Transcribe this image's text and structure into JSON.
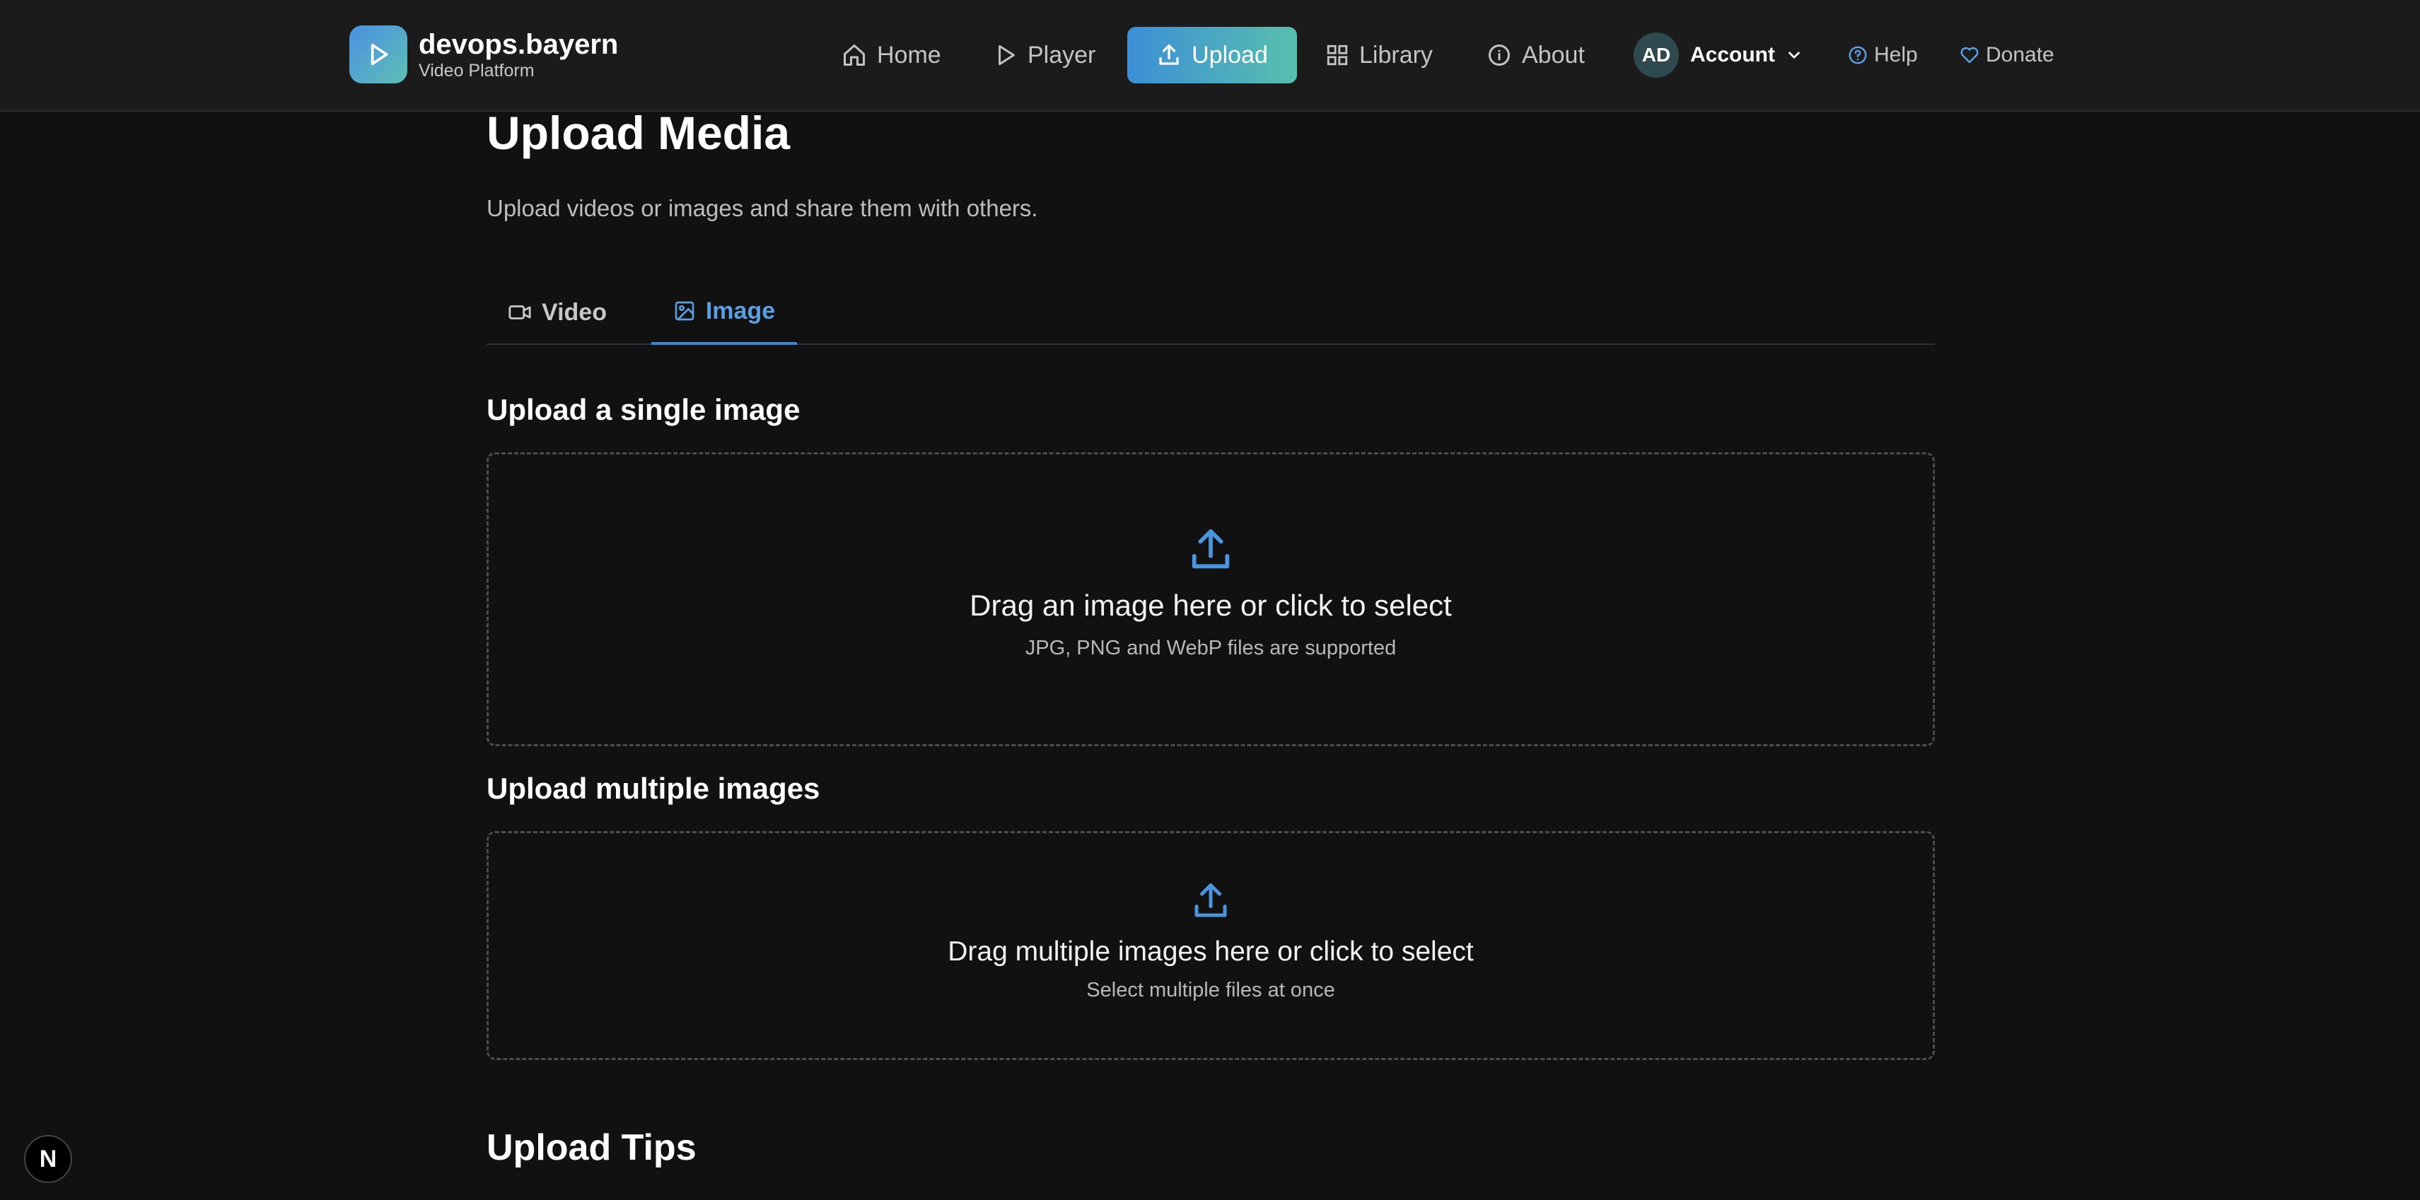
{
  "brand": {
    "name": "devops.bayern",
    "subtitle": "Video Platform"
  },
  "nav": {
    "home": "Home",
    "player": "Player",
    "upload": "Upload",
    "library": "Library",
    "about": "About",
    "account": "Account",
    "avatar_initials": "AD",
    "help": "Help",
    "donate": "Donate"
  },
  "page": {
    "title": "Upload Media",
    "subtitle": "Upload videos or images and share them with others."
  },
  "tabs": [
    {
      "label": "Video",
      "icon": "video-icon",
      "active": false
    },
    {
      "label": "Image",
      "icon": "image-icon",
      "active": true
    }
  ],
  "single": {
    "title": "Upload a single image",
    "main": "Drag an image here or click to select",
    "hint": "JPG, PNG and WebP files are supported"
  },
  "multiple": {
    "title": "Upload multiple images",
    "main": "Drag multiple images here or click to select",
    "hint": "Select multiple files at once"
  },
  "tips": {
    "title": "Upload Tips"
  },
  "badge": "N",
  "colors": {
    "accent": "#3c8fd6",
    "accent_teal": "#58bfae",
    "background": "#111111",
    "navbar": "#1b1b1b"
  }
}
